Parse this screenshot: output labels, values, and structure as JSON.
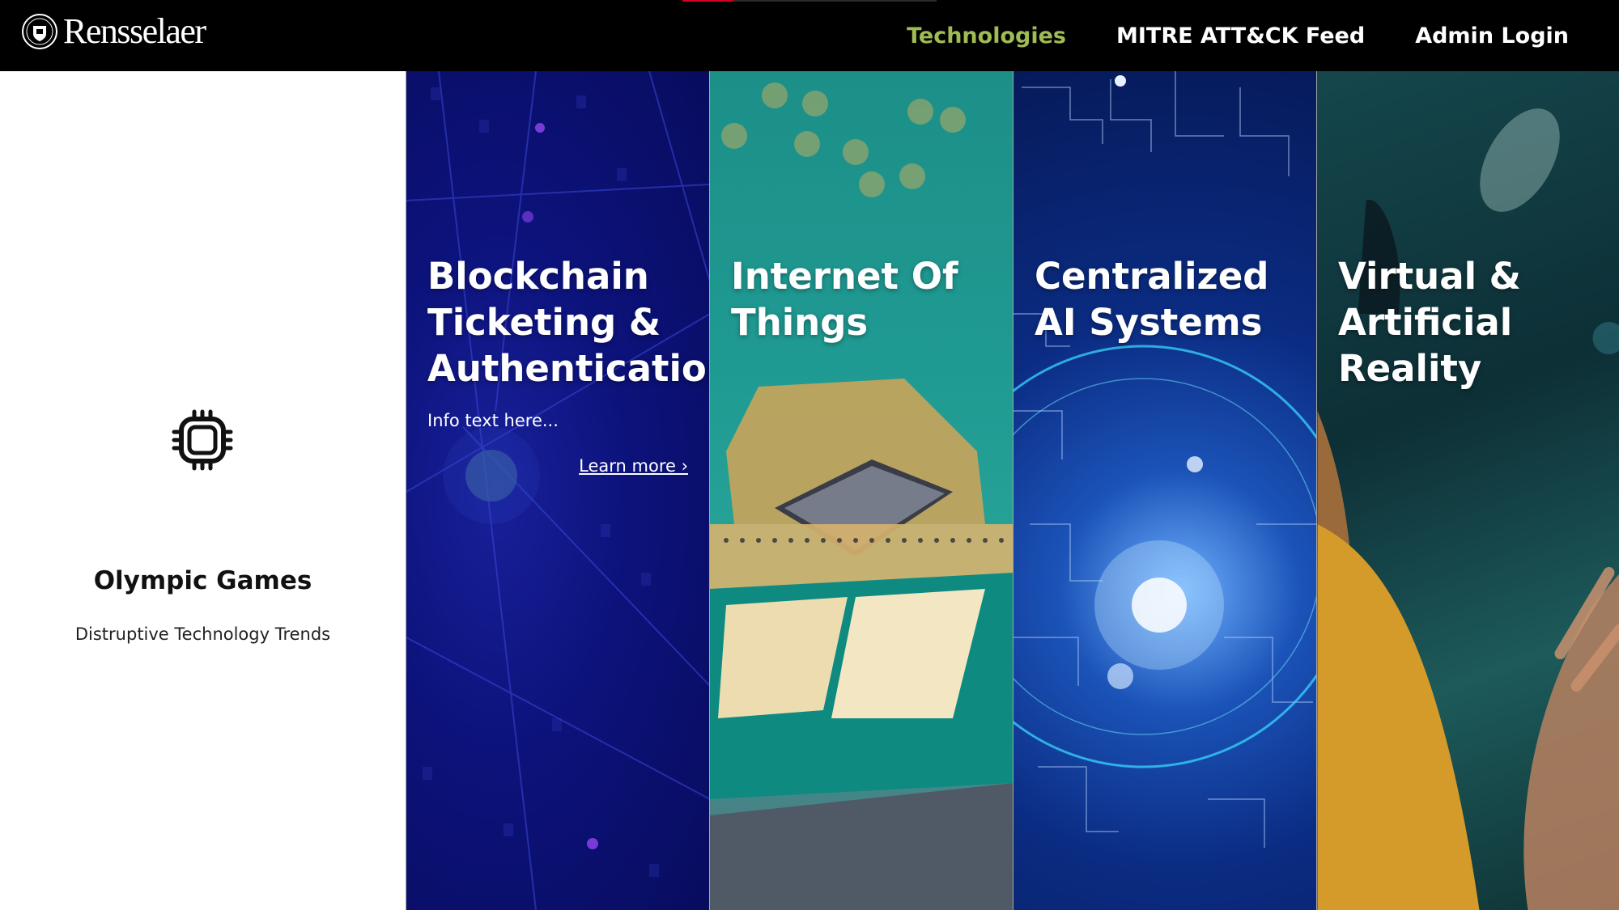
{
  "header": {
    "logo_text": "Rensselaer",
    "logo_icon": "seal-icon",
    "progress_fraction": 0.2,
    "nav": [
      {
        "label": "Technologies",
        "active": true
      },
      {
        "label": "MITRE ATT&CK Feed",
        "active": false
      },
      {
        "label": "Admin Login",
        "active": false
      }
    ]
  },
  "intro": {
    "icon": "chip-icon",
    "title": "Olympic Games",
    "subtitle": "Distruptive Technology Trends"
  },
  "panels": [
    {
      "title": "Blockchain Ticketing & Authentication",
      "info": "Info text here...",
      "link": "Learn more ›"
    },
    {
      "title": "Internet Of Things"
    },
    {
      "title": "Centralized AI Systems"
    },
    {
      "title": "Virtual & Artificial Reality"
    }
  ],
  "colors": {
    "header_bg": "#000000",
    "nav_active": "#9fbb54",
    "nav_text": "#ffffff",
    "progress_accent": "#d6001c"
  }
}
